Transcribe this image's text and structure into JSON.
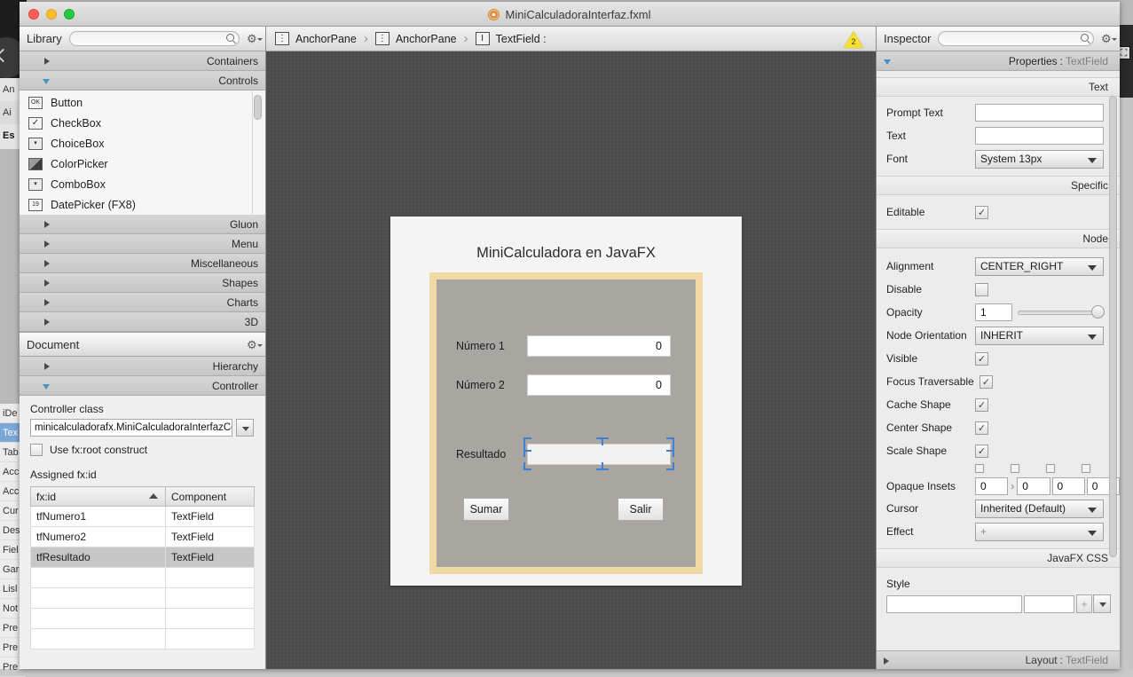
{
  "window": {
    "title": "MiniCalculadoraInterfaz.fxml",
    "doc_icon": "fxml-document-icon",
    "close_label": "",
    "minimize_label": "",
    "zoom_label": ""
  },
  "library": {
    "title": "Library",
    "search_placeholder": "",
    "search_value": "",
    "gear_icon": "gear-icon",
    "sections": [
      {
        "label": "Containers",
        "expanded": false
      },
      {
        "label": "Controls",
        "expanded": true
      }
    ],
    "items": [
      {
        "label": "Button",
        "icon": "ok-button-icon"
      },
      {
        "label": "CheckBox",
        "icon": "checkbox-icon"
      },
      {
        "label": "ChoiceBox",
        "icon": "choicebox-icon"
      },
      {
        "label": "ColorPicker",
        "icon": "colorpicker-icon"
      },
      {
        "label": "ComboBox",
        "icon": "combobox-icon"
      },
      {
        "label": "DatePicker  (FX8)",
        "icon": "datepicker-icon"
      }
    ],
    "more_sections": [
      {
        "label": "Gluon"
      },
      {
        "label": "Menu"
      },
      {
        "label": "Miscellaneous"
      },
      {
        "label": "Shapes"
      },
      {
        "label": "Charts"
      },
      {
        "label": "3D"
      }
    ]
  },
  "document": {
    "title": "Document",
    "gear_icon": "gear-icon",
    "sections": [
      {
        "label": "Hierarchy",
        "expanded": false
      },
      {
        "label": "Controller",
        "expanded": true
      }
    ],
    "controller_class_label": "Controller class",
    "controller_class_value": "minicalculadorafx.MiniCalculadoraInterfazContro",
    "use_fxroot_label": "Use fx:root construct",
    "use_fxroot_checked": false,
    "assigned_fxid_label": "Assigned fx:id",
    "table": {
      "columns": [
        "fx:id",
        "Component"
      ],
      "sort_column": "fx:id",
      "rows": [
        {
          "fxid": "tfNumero1",
          "component": "TextField",
          "selected": false
        },
        {
          "fxid": "tfNumero2",
          "component": "TextField",
          "selected": false
        },
        {
          "fxid": "tfResultado",
          "component": "TextField",
          "selected": true
        },
        {
          "fxid": "",
          "component": "",
          "selected": false
        },
        {
          "fxid": "",
          "component": "",
          "selected": false
        },
        {
          "fxid": "",
          "component": "",
          "selected": false
        },
        {
          "fxid": "",
          "component": "",
          "selected": false
        }
      ]
    }
  },
  "breadcrumb": {
    "items": [
      {
        "label": "AnchorPane",
        "icon": "anchorpane-icon"
      },
      {
        "label": "AnchorPane",
        "icon": "anchorpane-icon"
      },
      {
        "label": "TextField :",
        "icon": "textfield-icon"
      }
    ],
    "separator": "›",
    "warning_count": "2",
    "warning_icon": "warning-triangle-icon"
  },
  "stage": {
    "form_title": "MiniCalculadora en JavaFX",
    "accent_border_color": "#f0d9a4",
    "pane_color": "#a9a5a1",
    "fields": [
      {
        "label": "Número 1",
        "value": "0",
        "name": "tfNumero1"
      },
      {
        "label": "Número 2",
        "value": "0",
        "name": "tfNumero2"
      }
    ],
    "result": {
      "label": "Resultado",
      "value": "",
      "name": "tfResultado",
      "selected": true
    },
    "buttons": [
      {
        "label": "Sumar",
        "name": "sumar-button"
      },
      {
        "label": "Salir",
        "name": "salir-button"
      }
    ]
  },
  "inspector": {
    "title": "Inspector",
    "search_placeholder": "",
    "search_value": "",
    "gear_icon": "gear-icon",
    "properties_header": "Properties",
    "properties_target": "TextField",
    "sections": {
      "text": "Text",
      "specific": "Specific",
      "node": "Node",
      "javafx_css": "JavaFX CSS"
    },
    "text_props": [
      {
        "label": "Prompt Text",
        "value": "",
        "type": "input",
        "name": "prompt-text-field"
      },
      {
        "label": "Text",
        "value": "",
        "type": "input",
        "name": "text-field"
      },
      {
        "label": "Font",
        "value": "System 13px",
        "type": "combo",
        "name": "font-combo"
      }
    ],
    "specific_props": [
      {
        "label": "Editable",
        "checked": true,
        "type": "checkbox",
        "name": "editable-checkbox"
      }
    ],
    "node_props": [
      {
        "label": "Alignment",
        "value": "CENTER_RIGHT",
        "type": "combo",
        "name": "alignment-combo"
      },
      {
        "label": "Disable",
        "checked": false,
        "type": "checkbox",
        "name": "disable-checkbox"
      },
      {
        "label": "Opacity",
        "value": "1",
        "type": "slider",
        "name": "opacity-field"
      },
      {
        "label": "Node Orientation",
        "value": "INHERIT",
        "type": "combo",
        "name": "node-orientation-combo"
      },
      {
        "label": "Visible",
        "checked": true,
        "type": "checkbox",
        "name": "visible-checkbox"
      },
      {
        "label": "Focus Traversable",
        "checked": true,
        "type": "checkbox",
        "name": "focus-traversable-checkbox"
      },
      {
        "label": "Cache Shape",
        "checked": true,
        "type": "checkbox",
        "name": "cache-shape-checkbox"
      },
      {
        "label": "Center Shape",
        "checked": true,
        "type": "checkbox",
        "name": "center-shape-checkbox"
      },
      {
        "label": "Scale Shape",
        "checked": true,
        "type": "checkbox",
        "name": "scale-shape-checkbox"
      }
    ],
    "opaque_insets": {
      "label": "Opaque Insets",
      "values": [
        "0",
        "0",
        "0",
        "0"
      ],
      "separator": "›"
    },
    "cursor": {
      "label": "Cursor",
      "value": "Inherited (Default)"
    },
    "effect": {
      "label": "Effect",
      "value": "+"
    },
    "style": {
      "label": "Style",
      "value": "",
      "value2": "",
      "add_label": "+"
    },
    "footer": {
      "label": "Layout",
      "target": "TextField"
    }
  },
  "background": {
    "left_items": [
      "iDe",
      "Tex",
      "Tab",
      "Acc",
      "Acc",
      "Cur",
      "Des",
      "Fiel",
      "Gar",
      "Lisl",
      "Not",
      "Pre",
      "Pre",
      "Pre"
    ],
    "top_items": [
      "An",
      "Ai",
      "Es"
    ]
  }
}
